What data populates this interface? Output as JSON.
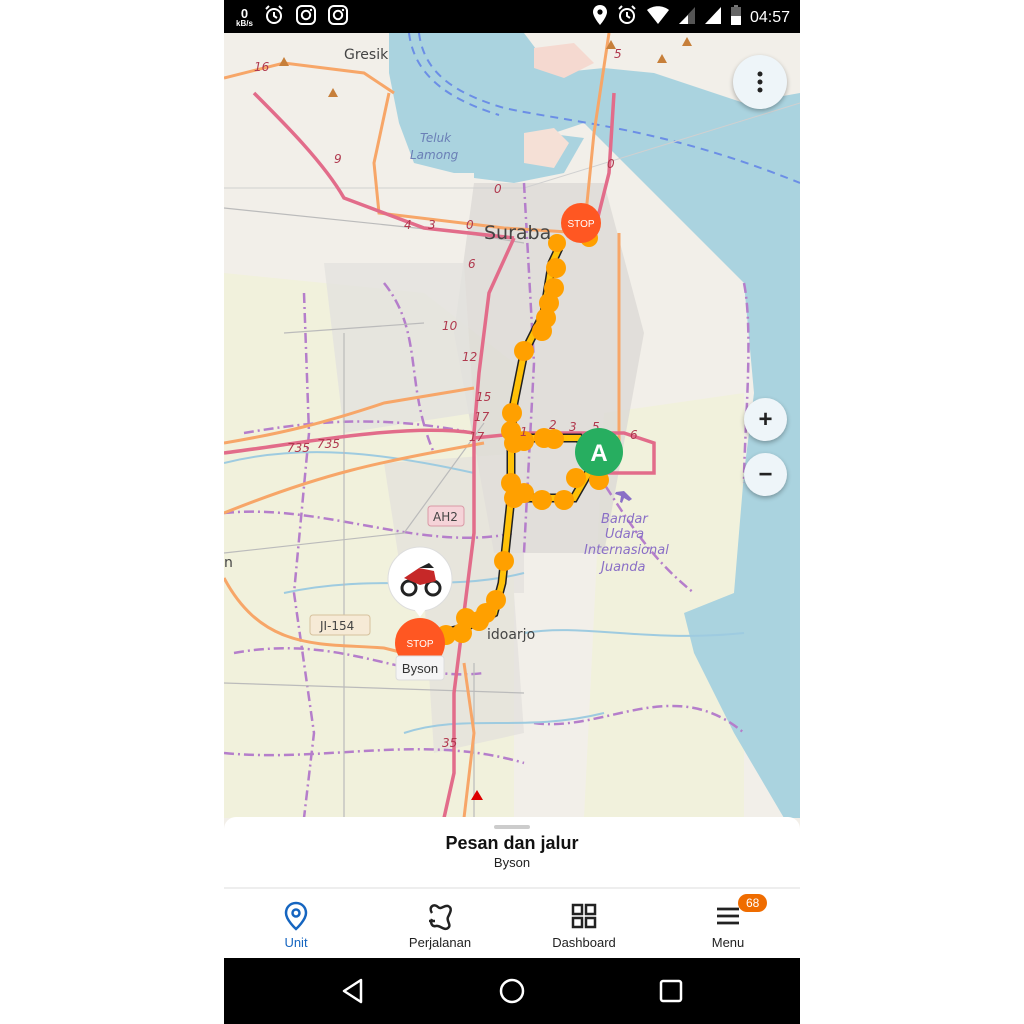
{
  "status_bar": {
    "net_speed_value": "0",
    "net_speed_unit": "kB/s",
    "left_icons": [
      "alarm-icon",
      "instagram-icon",
      "instagram-icon"
    ],
    "right_icons": [
      "location-icon",
      "alarm-icon",
      "wifi-icon",
      "signal-icon",
      "signal-icon",
      "battery-icon"
    ],
    "time": "04:57"
  },
  "map": {
    "place_labels": [
      {
        "name": "Gresik"
      },
      {
        "name": "Teluk Lamong"
      },
      {
        "name": "Surabaya",
        "visible_text": "Suraba"
      },
      {
        "name": "Sidoarjo",
        "visible_text": "idoarjo"
      },
      {
        "name": "Bandar Udara Internasional Juanda"
      }
    ],
    "road_refs": [
      "16",
      "9",
      "4",
      "3",
      "0",
      "0",
      "0",
      "5",
      "6",
      "10",
      "12",
      "15",
      "17",
      "17",
      "1",
      "2",
      "3",
      "5",
      "6",
      "735",
      "735",
      "35"
    ],
    "road_shields": [
      "AH2",
      "JI-154"
    ],
    "edge_label": "n",
    "markers": [
      {
        "type": "stop",
        "label": "STOP"
      },
      {
        "type": "stop",
        "label": "STOP"
      },
      {
        "type": "waypoint",
        "label": "A"
      }
    ],
    "vehicle_name": "Byson",
    "route_color": "#ffa000",
    "stop_color": "#ff5722",
    "waypoint_color": "#27ae60"
  },
  "controls": {
    "more_icon": "more-vert-icon",
    "zoom_in": "+",
    "zoom_out": "−"
  },
  "sheet": {
    "title": "Pesan dan jalur",
    "subtitle": "Byson"
  },
  "bottom_nav": {
    "items": [
      {
        "label": "Unit",
        "icon": "location-pin-icon",
        "active": true
      },
      {
        "label": "Perjalanan",
        "icon": "route-icon",
        "active": false
      },
      {
        "label": "Dashboard",
        "icon": "grid-icon",
        "active": false
      },
      {
        "label": "Menu",
        "icon": "hamburger-icon",
        "active": false,
        "badge": "68"
      }
    ],
    "active_color": "#1565c0",
    "badge_color": "#ef6c00"
  },
  "system_nav": [
    "back-icon",
    "home-icon",
    "recents-icon"
  ]
}
